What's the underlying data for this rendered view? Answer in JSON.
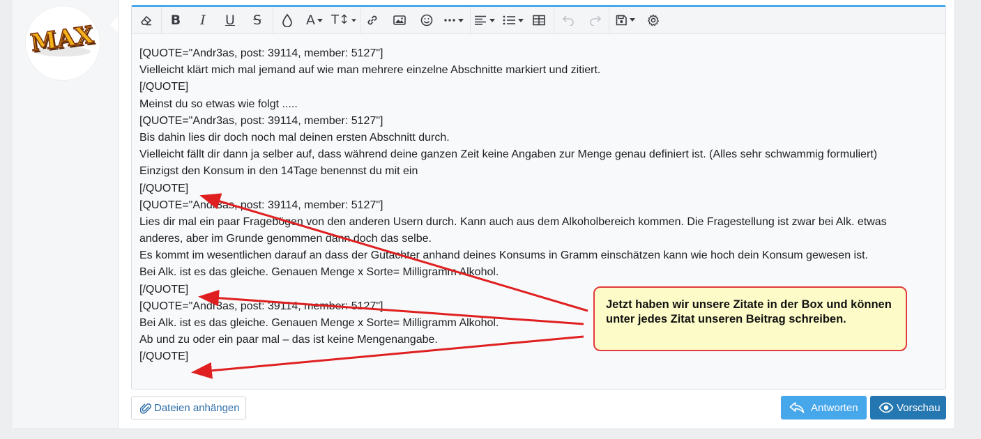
{
  "user": {
    "avatar_text": "MAX"
  },
  "toolbar": {
    "icons": [
      "eraser-icon",
      "bold-icon",
      "italic-icon",
      "underline-icon",
      "strikethrough-icon",
      "text-color-icon",
      "font-family-icon",
      "font-size-icon",
      "link-icon",
      "image-icon",
      "smilie-icon",
      "more-icon",
      "align-icon",
      "list-icon",
      "table-icon",
      "undo-icon",
      "redo-icon",
      "drafts-icon",
      "settings-icon"
    ],
    "bold_label": "B",
    "italic_label": "I",
    "underline_label": "U",
    "strike_label": "S",
    "font_label": "A",
    "size_label": "T↕"
  },
  "editor": {
    "lines": [
      "[QUOTE=\"Andr3as, post: 39114, member: 5127\"]",
      "Vielleicht klärt mich mal jemand auf wie man mehrere einzelne Abschnitte markiert und zitiert.",
      "[/QUOTE]",
      "Meinst du so etwas wie folgt .....",
      "[QUOTE=\"Andr3as, post: 39114, member: 5127\"]",
      "Bis dahin lies dir doch noch mal deinen ersten Abschnitt durch.",
      "Vielleicht fällt dir dann ja selber auf, dass während deine ganzen Zeit keine Angaben zur Menge genau definiert ist. (Alles sehr schwammig formuliert)",
      "Einzigst den Konsum in den 14Tage benennst du mit ein",
      "[/QUOTE]",
      "[QUOTE=\"Andr3as, post: 39114, member: 5127\"]",
      "Lies dir mal ein paar Fragebögen von den anderen Usern durch. Kann auch aus dem Alkoholbereich kommen. Die Fragestellung ist zwar bei Alk. etwas",
      "anderes, aber im Grunde genommen dann doch das selbe.",
      "Es kommt im wesentlichen darauf an dass der Gutachter anhand deines Konsums in Gramm einschätzen kann wie hoch dein Konsum gewesen ist.",
      "Bei Alk. ist es das gleiche. Genauen Menge x Sorte= Milligramm Alkohol.",
      "[/QUOTE]",
      "[QUOTE=\"Andr3as, post: 39114, member: 5127\"]",
      "Bei Alk. ist es das gleiche. Genauen Menge x Sorte= Milligramm Alkohol.",
      "Ab und zu oder ein paar mal – das ist keine Mengenangabe.",
      "[/QUOTE]"
    ]
  },
  "annotation": {
    "callout_text": "Jetzt haben wir unsere Zitate in der Box und können unter jedes Zitat unseren Beitrag schreiben.",
    "color": "#e02020"
  },
  "buttons": {
    "attach_label": "Dateien anhängen",
    "reply_label": "Antworten",
    "preview_label": "Vorschau"
  },
  "colors": {
    "accent": "#47a7eb",
    "primary": "#2577b1",
    "link": "#2f6fa8"
  }
}
